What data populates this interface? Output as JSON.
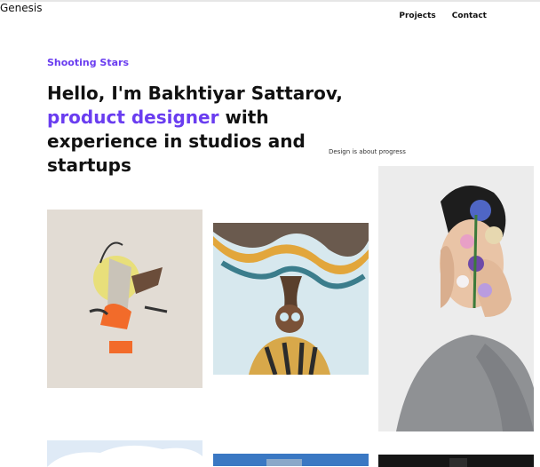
{
  "header": {
    "brand": "Genesis",
    "nav": [
      {
        "label": "Projects"
      },
      {
        "label": "Contact"
      }
    ]
  },
  "hero": {
    "eyebrow": "Shooting Stars",
    "headline_intro": "Hello, I'm Bakhtiyar Sattarov,",
    "headline_accent": "product designer",
    "headline_rest": " with experience in studios and startups",
    "caption": "Design is about progress"
  },
  "colors": {
    "accent": "#6a3df0",
    "text": "#111111"
  }
}
